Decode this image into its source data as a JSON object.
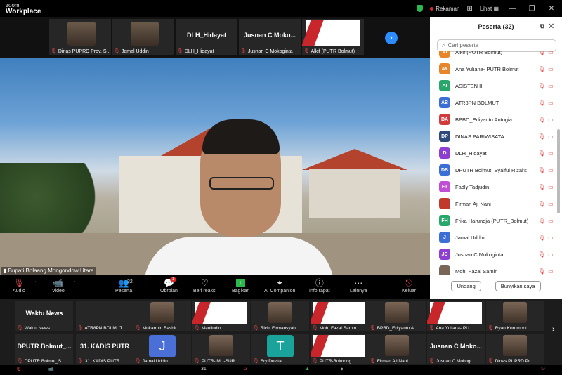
{
  "app": {
    "logo_small": "zoom",
    "logo_big": "Workplace"
  },
  "titlebar": {
    "record_label": "Rekaman",
    "view_label": "Lihat"
  },
  "strip": [
    {
      "label": "Dinas PUPRD Prov. S...",
      "kind": "photo",
      "big": ""
    },
    {
      "label": "Jamal Uddin",
      "kind": "photo",
      "big": ""
    },
    {
      "label": "DLH_Hidayat",
      "kind": "name",
      "big": "DLH_Hidayat"
    },
    {
      "label": "Jusnan C Mokoginta",
      "kind": "name",
      "big": "Jusnan C Moko..."
    },
    {
      "label": "Alkif (PUTR Bolmut)",
      "kind": "doc",
      "big": ""
    }
  ],
  "speaker": {
    "label": "Bupati Bolaang Mongondow Utara"
  },
  "toolbar": {
    "audio": "Audio",
    "video": "Video",
    "participants": "Peserta",
    "participants_count": "32",
    "chat": "Obrolan",
    "chat_badge": "1",
    "react": "Beri reaksi",
    "share": "Bagikan",
    "ai": "AI Companion",
    "info": "Info rapat",
    "more": "Lainnya",
    "leave": "Keluar"
  },
  "panel": {
    "title": "Peserta (32)",
    "search_placeholder": "Cari peserta",
    "participants": [
      {
        "initials": "AI",
        "name": "Alkif (PUTR Bolmut)",
        "color": "#e8842a"
      },
      {
        "initials": "AY",
        "name": "Ana Yuliana- PUTR Bolmut",
        "color": "#e8842a"
      },
      {
        "initials": "AI",
        "name": "ASISTEN II",
        "color": "#27a86a"
      },
      {
        "initials": "AB",
        "name": "ATR8PN BOLMUT",
        "color": "#3b6fd6"
      },
      {
        "initials": "BA",
        "name": "BPBD_Ediyanto Antogia",
        "color": "#d23b3b"
      },
      {
        "initials": "DP",
        "name": "DINAS PARIWISATA",
        "color": "#2e4a7a"
      },
      {
        "initials": "D",
        "name": "DLH_Hidayat",
        "color": "#8e3fd1"
      },
      {
        "initials": "DB",
        "name": "DPUTR Bolmut_Syaiful Rizal's",
        "color": "#3b6fd6"
      },
      {
        "initials": "FT",
        "name": "Fadly Tadjudin",
        "color": "#c04fd6"
      },
      {
        "initials": "",
        "name": "Firman Aji Nani",
        "color": "#c0392b"
      },
      {
        "initials": "FH",
        "name": "Frika Harundja (PUTR_Bolmut)",
        "color": "#27a86a"
      },
      {
        "initials": "J",
        "name": "Jamal Uddin",
        "color": "#3b6fd6"
      },
      {
        "initials": "JC",
        "name": "Jusnan C Mokoginta",
        "color": "#8e3fd1"
      },
      {
        "initials": "",
        "name": "Moh. Fazal Samin",
        "color": "#7a6656"
      }
    ],
    "invite": "Undang",
    "mute_me": "Bunyikan saya"
  },
  "gallery": [
    {
      "label": "Waktu News",
      "big": "Waktu News",
      "kind": "name"
    },
    {
      "label": "ATR8PN BOLMUT",
      "big": "",
      "kind": "dark"
    },
    {
      "label": "Mukarmin Bashir",
      "big": "",
      "kind": "photo"
    },
    {
      "label": "Maulludin",
      "big": "",
      "kind": "doc"
    },
    {
      "label": "Richi Firmansyah",
      "big": "",
      "kind": "photo"
    },
    {
      "label": "Moh. Fazal Samin",
      "big": "",
      "kind": "doc"
    },
    {
      "label": "BPBD_Ediyanto A...",
      "big": "",
      "kind": "photo"
    },
    {
      "label": "Ana Yuliana- PU...",
      "big": "",
      "kind": "doc"
    },
    {
      "label": "Ryan Korompot",
      "big": "",
      "kind": "photo"
    },
    {
      "label": "DPUTR Bolmut_S...",
      "big": "DPUTR Bolmut_...",
      "kind": "name"
    },
    {
      "label": "31. KADIS PUTR",
      "big": "31. KADIS PUTR",
      "kind": "name"
    },
    {
      "label": "Jamal Uddin",
      "big": "J",
      "kind": "letter",
      "color": "#4a6fd6"
    },
    {
      "label": "PUTR-IMU-SUR...",
      "big": "",
      "kind": "photo"
    },
    {
      "label": "Sry Devita",
      "big": "T",
      "kind": "letter",
      "color": "#1aa39a"
    },
    {
      "label": "PUTR-Bolmong...",
      "big": "",
      "kind": "doc"
    },
    {
      "label": "Firman Aji Nani",
      "big": "",
      "kind": "photo"
    },
    {
      "label": "Jusnan C Mokogi...",
      "big": "Jusnan C Moko...",
      "kind": "name"
    },
    {
      "label": "Dinas PUPRD Pr...",
      "big": "",
      "kind": "photo"
    }
  ],
  "bottombar": {
    "participants_count": "31",
    "chat_badge": "2"
  }
}
